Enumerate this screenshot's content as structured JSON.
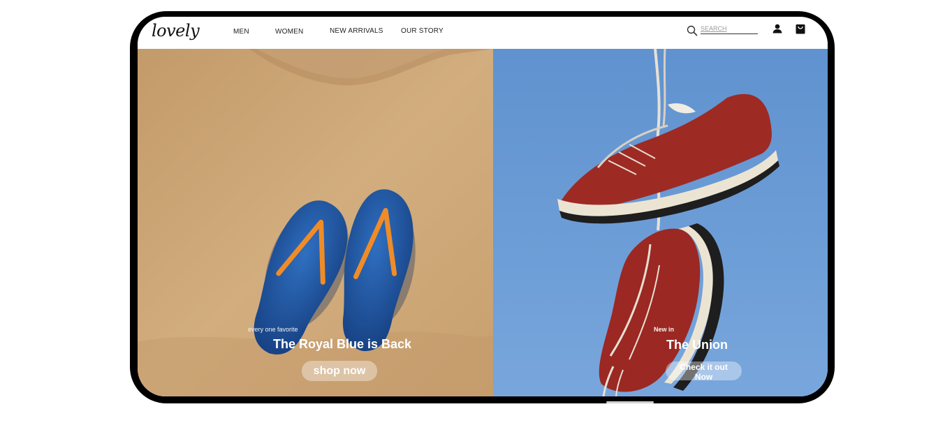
{
  "brand": {
    "logo": "lovely"
  },
  "nav": {
    "links": [
      "MEN",
      "WOMEN",
      "NEW ARRIVALS",
      "OUR STORY"
    ],
    "search_placeholder": "SEARCH",
    "icons": [
      "search-icon",
      "user-icon",
      "shopping-bag-icon"
    ]
  },
  "hero": {
    "left": {
      "kicker": "every one favorite",
      "title": "The Royal Blue is Back",
      "cta": "shop now"
    },
    "right": {
      "kicker": "New in",
      "title": "The Union",
      "cta": "Check it out Now"
    }
  },
  "colors": {
    "device_frame": "#000000",
    "sand": "#caa577",
    "sky": "#6b9bd2",
    "flipflop_blue": "#1d4f9a",
    "strap_orange": "#f08c28",
    "sneaker_red": "#9e2a24"
  }
}
